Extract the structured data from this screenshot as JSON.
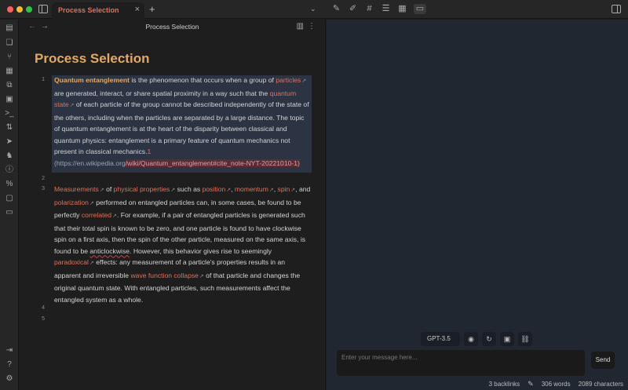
{
  "tab": {
    "title": "Process Selection",
    "close": "×",
    "new": "+"
  },
  "editor": {
    "header_title": "Process Selection",
    "doc_title": "Process Selection",
    "line_numbers": [
      "1",
      "2",
      "3",
      "4",
      "5"
    ],
    "para1": {
      "p1_link": "Quantum entanglement",
      "p1_t1": " is the phenomenon that occurs when a group of ",
      "p1_link2": "particles",
      "p1_t2": " are generated, interact, or share spatial proximity in a way such that the ",
      "p1_link3": "quantum state",
      "p1_t3": " of each particle of the group cannot be described independently of the state of the others, including when the particles are separated by a large distance. The topic of quantum entanglement is at the heart of the disparity between classical and quantum physics: entanglement is a primary feature of quantum mechanics not present in classical mechanics.",
      "p1_fn": "1",
      "p1_url_a": "(https://en.wikipedia.org",
      "p1_url_b": "/wiki/Quantum_entanglement#cite_note-NYT-20221010-1)"
    },
    "para3": {
      "p3_l1": "Measurements",
      "p3_t1": " of ",
      "p3_l2": "physical properties",
      "p3_t2": " such as ",
      "p3_l3": "position",
      "p3_t3": ", ",
      "p3_l4": "momentum",
      "p3_t4": ", ",
      "p3_l5": "spin",
      "p3_t5": ", and ",
      "p3_l6": "polarization",
      "p3_t6": " performed on entangled particles can, in some cases, be found to be perfectly ",
      "p3_l7": "correlated",
      "p3_t7": ". For example, if a pair of entangled particles is generated such that their total spin is known to be zero, and one particle is found to have clockwise spin on a first axis, then the spin of the other particle, measured on the same axis, is found to be ",
      "p3_u": "anticlockwise",
      "p3_t8": ". However, this behavior gives rise to seemingly ",
      "p3_l8": "paradoxical",
      "p3_t9": " effects: any measurement of a particle's properties results in an apparent and irreversible ",
      "p3_l9": "wave function collapse",
      "p3_t10": " of that particle and changes the original quantum state. With entangled particles, such measurements affect the entangled system as a whole."
    }
  },
  "chat": {
    "model": "GPT-3.5",
    "placeholder": "Enter your message here...",
    "send_label": "Send"
  },
  "status": {
    "backlinks": "3 backlinks",
    "words": "306 words",
    "characters": "2089 characters"
  },
  "colors": {
    "accent": "#e2705a",
    "title": "#e6a95b",
    "chat_bg": "#212731"
  }
}
